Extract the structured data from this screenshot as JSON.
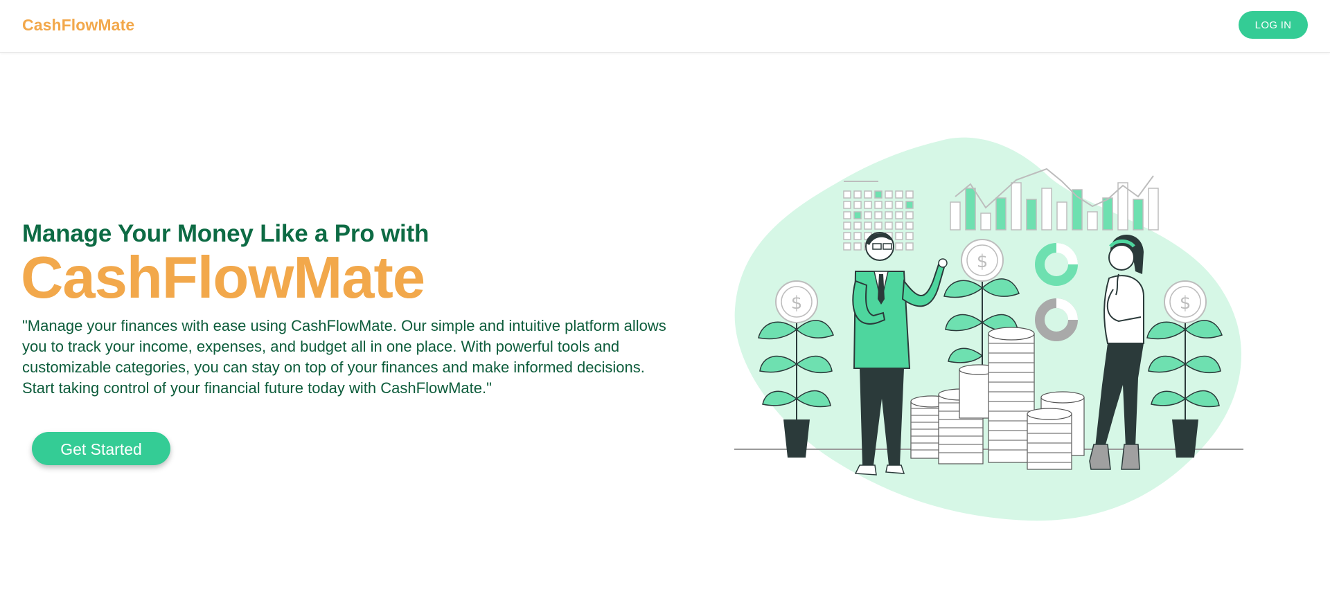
{
  "header": {
    "brand": "CashFlowMate",
    "login_label": "LOG IN"
  },
  "hero": {
    "headline": "Manage Your Money Like a Pro with",
    "brand_highlight": "CashFlowMate",
    "description": "\"Manage your finances with ease using CashFlowMate. Our simple and intuitive platform allows you to track your income, expenses, and budget all in one place. With powerful tools and customizable categories, you can stay on top of your finances and make informed decisions. Start taking control of your financial future today with CashFlowMate.\"",
    "cta_label": "Get Started"
  },
  "colors": {
    "brand_orange": "#f2a84b",
    "accent_green": "#34cc95",
    "heading_green": "#0d6b44",
    "blob_mint": "#d6f7e6"
  },
  "illustration": {
    "icon": "finance-people-coins-illustration"
  }
}
